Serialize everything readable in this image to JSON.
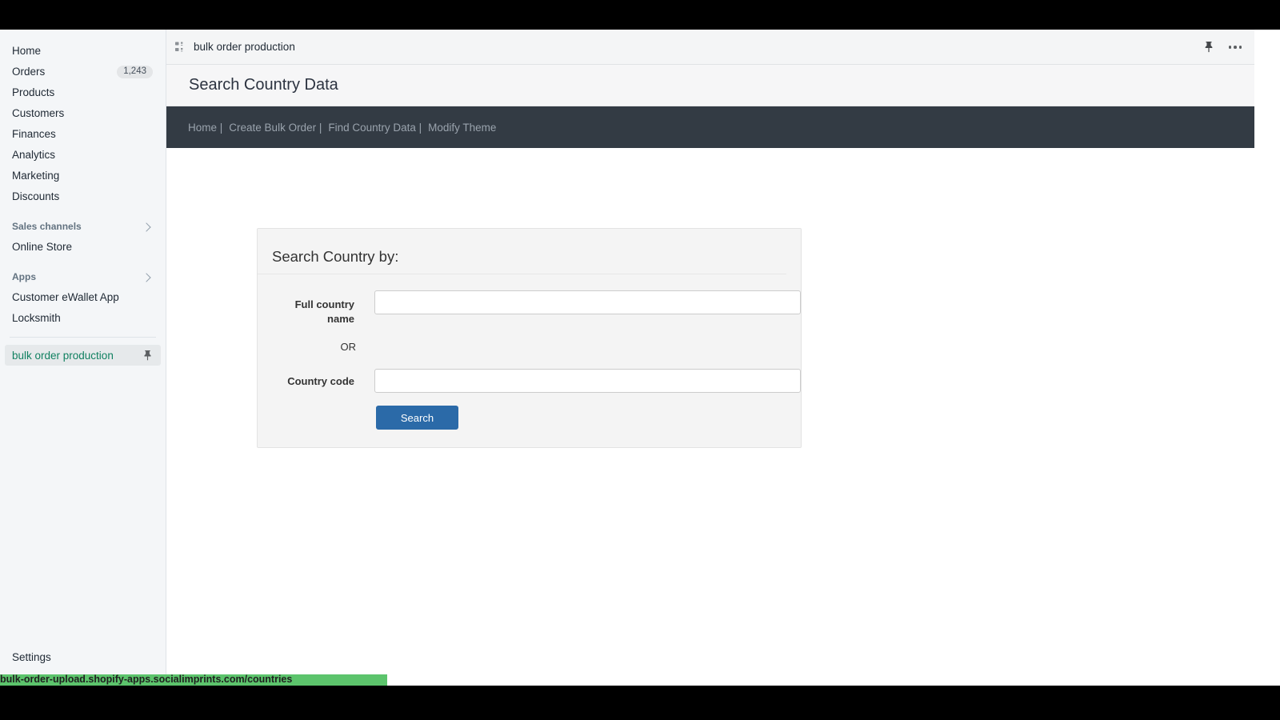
{
  "sidebar": {
    "items": [
      {
        "label": "Home",
        "badge": null
      },
      {
        "label": "Orders",
        "badge": "1,243"
      },
      {
        "label": "Products",
        "badge": null
      },
      {
        "label": "Customers",
        "badge": null
      },
      {
        "label": "Finances",
        "badge": null
      },
      {
        "label": "Analytics",
        "badge": null
      },
      {
        "label": "Marketing",
        "badge": null
      },
      {
        "label": "Discounts",
        "badge": null
      }
    ],
    "sections": [
      {
        "title": "Sales channels",
        "chevron_icon": "chevron-right-icon",
        "items": [
          {
            "label": "Online Store"
          }
        ]
      },
      {
        "title": "Apps",
        "chevron_icon": "chevron-right-icon",
        "items": [
          {
            "label": "Customer eWallet App"
          },
          {
            "label": "Locksmith"
          }
        ]
      }
    ],
    "active_item": {
      "label": "bulk order production",
      "color": "#108060",
      "pin_icon": "pin-icon"
    },
    "footer": {
      "label": "Settings"
    }
  },
  "titlebar": {
    "app_icon": "grid-apps-icon",
    "title": "bulk order production",
    "pin_icon": "pin-icon",
    "overflow_icon": "ellipsis-icon"
  },
  "page": {
    "title": "Search Country Data"
  },
  "darknav": {
    "background": "#333b44",
    "links": [
      "Home |",
      "Create Bulk Order |",
      "Find Country Data |",
      "Modify Theme"
    ]
  },
  "form": {
    "heading": "Search Country by:",
    "country_name": {
      "label": "Full country name",
      "value": "",
      "placeholder": ""
    },
    "or_text": "OR",
    "country_code": {
      "label": "Country code",
      "value": "",
      "placeholder": ""
    },
    "submit_label": "Search",
    "submit_color": "#2b6aa8"
  },
  "statusbar": {
    "url": "bulk-order-upload.shopify-apps.socialimprints.com/countries",
    "background": "#5cc46c"
  }
}
